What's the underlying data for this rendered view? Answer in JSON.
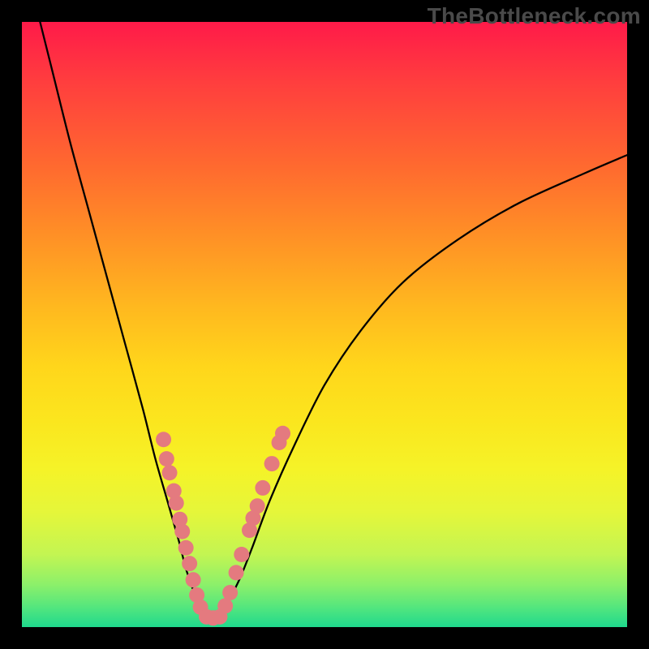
{
  "watermark": "TheBottleneck.com",
  "colors": {
    "frame_bg": "#000000",
    "curve_stroke": "#000000",
    "dot_fill": "#e47a7f",
    "gradient_top": "#ff1a49",
    "gradient_bottom": "#1fd98d"
  },
  "chart_data": {
    "type": "line",
    "title": "",
    "xlabel": "",
    "ylabel": "",
    "xlim": [
      0,
      100
    ],
    "ylim": [
      0,
      100
    ],
    "series": [
      {
        "name": "bottleneck-curve",
        "x": [
          3,
          5,
          8,
          11,
          14,
          17,
          20,
          22,
          24,
          26,
          27,
          28,
          29,
          30,
          31,
          32,
          33,
          34,
          36,
          38,
          41,
          45,
          50,
          56,
          63,
          72,
          82,
          93,
          100
        ],
        "y": [
          100,
          92,
          80,
          69,
          58,
          47,
          36,
          28,
          21,
          14,
          10,
          7,
          4,
          2,
          1,
          1,
          2,
          4,
          8,
          13,
          21,
          30,
          40,
          49,
          57,
          64,
          70,
          75,
          78
        ]
      }
    ],
    "points": [
      {
        "name": "left-cluster",
        "x": 23.4,
        "y": 31.0
      },
      {
        "name": "left-cluster",
        "x": 23.9,
        "y": 27.8
      },
      {
        "name": "left-cluster",
        "x": 24.4,
        "y": 25.5
      },
      {
        "name": "left-cluster",
        "x": 25.1,
        "y": 22.5
      },
      {
        "name": "left-cluster",
        "x": 25.5,
        "y": 20.5
      },
      {
        "name": "left-cluster",
        "x": 26.1,
        "y": 17.8
      },
      {
        "name": "left-cluster",
        "x": 26.5,
        "y": 15.8
      },
      {
        "name": "left-cluster",
        "x": 27.1,
        "y": 13.1
      },
      {
        "name": "left-cluster",
        "x": 27.7,
        "y": 10.5
      },
      {
        "name": "left-cluster",
        "x": 28.3,
        "y": 7.8
      },
      {
        "name": "left-cluster",
        "x": 28.9,
        "y": 5.3
      },
      {
        "name": "left-cluster",
        "x": 29.5,
        "y": 3.3
      },
      {
        "name": "bottom-flat",
        "x": 30.5,
        "y": 1.7
      },
      {
        "name": "bottom-flat",
        "x": 31.6,
        "y": 1.5
      },
      {
        "name": "bottom-flat",
        "x": 32.7,
        "y": 1.7
      },
      {
        "name": "right-cluster",
        "x": 33.6,
        "y": 3.5
      },
      {
        "name": "right-cluster",
        "x": 34.4,
        "y": 5.7
      },
      {
        "name": "right-cluster",
        "x": 35.4,
        "y": 9.0
      },
      {
        "name": "right-cluster",
        "x": 36.3,
        "y": 12.0
      },
      {
        "name": "right-cluster",
        "x": 37.6,
        "y": 16.0
      },
      {
        "name": "right-cluster",
        "x": 38.2,
        "y": 18.0
      },
      {
        "name": "right-cluster",
        "x": 38.9,
        "y": 20.0
      },
      {
        "name": "right-cluster",
        "x": 39.8,
        "y": 23.0
      },
      {
        "name": "right-cluster",
        "x": 41.3,
        "y": 27.0
      },
      {
        "name": "right-cluster",
        "x": 42.5,
        "y": 30.5
      },
      {
        "name": "right-cluster",
        "x": 43.1,
        "y": 32.0
      }
    ]
  }
}
